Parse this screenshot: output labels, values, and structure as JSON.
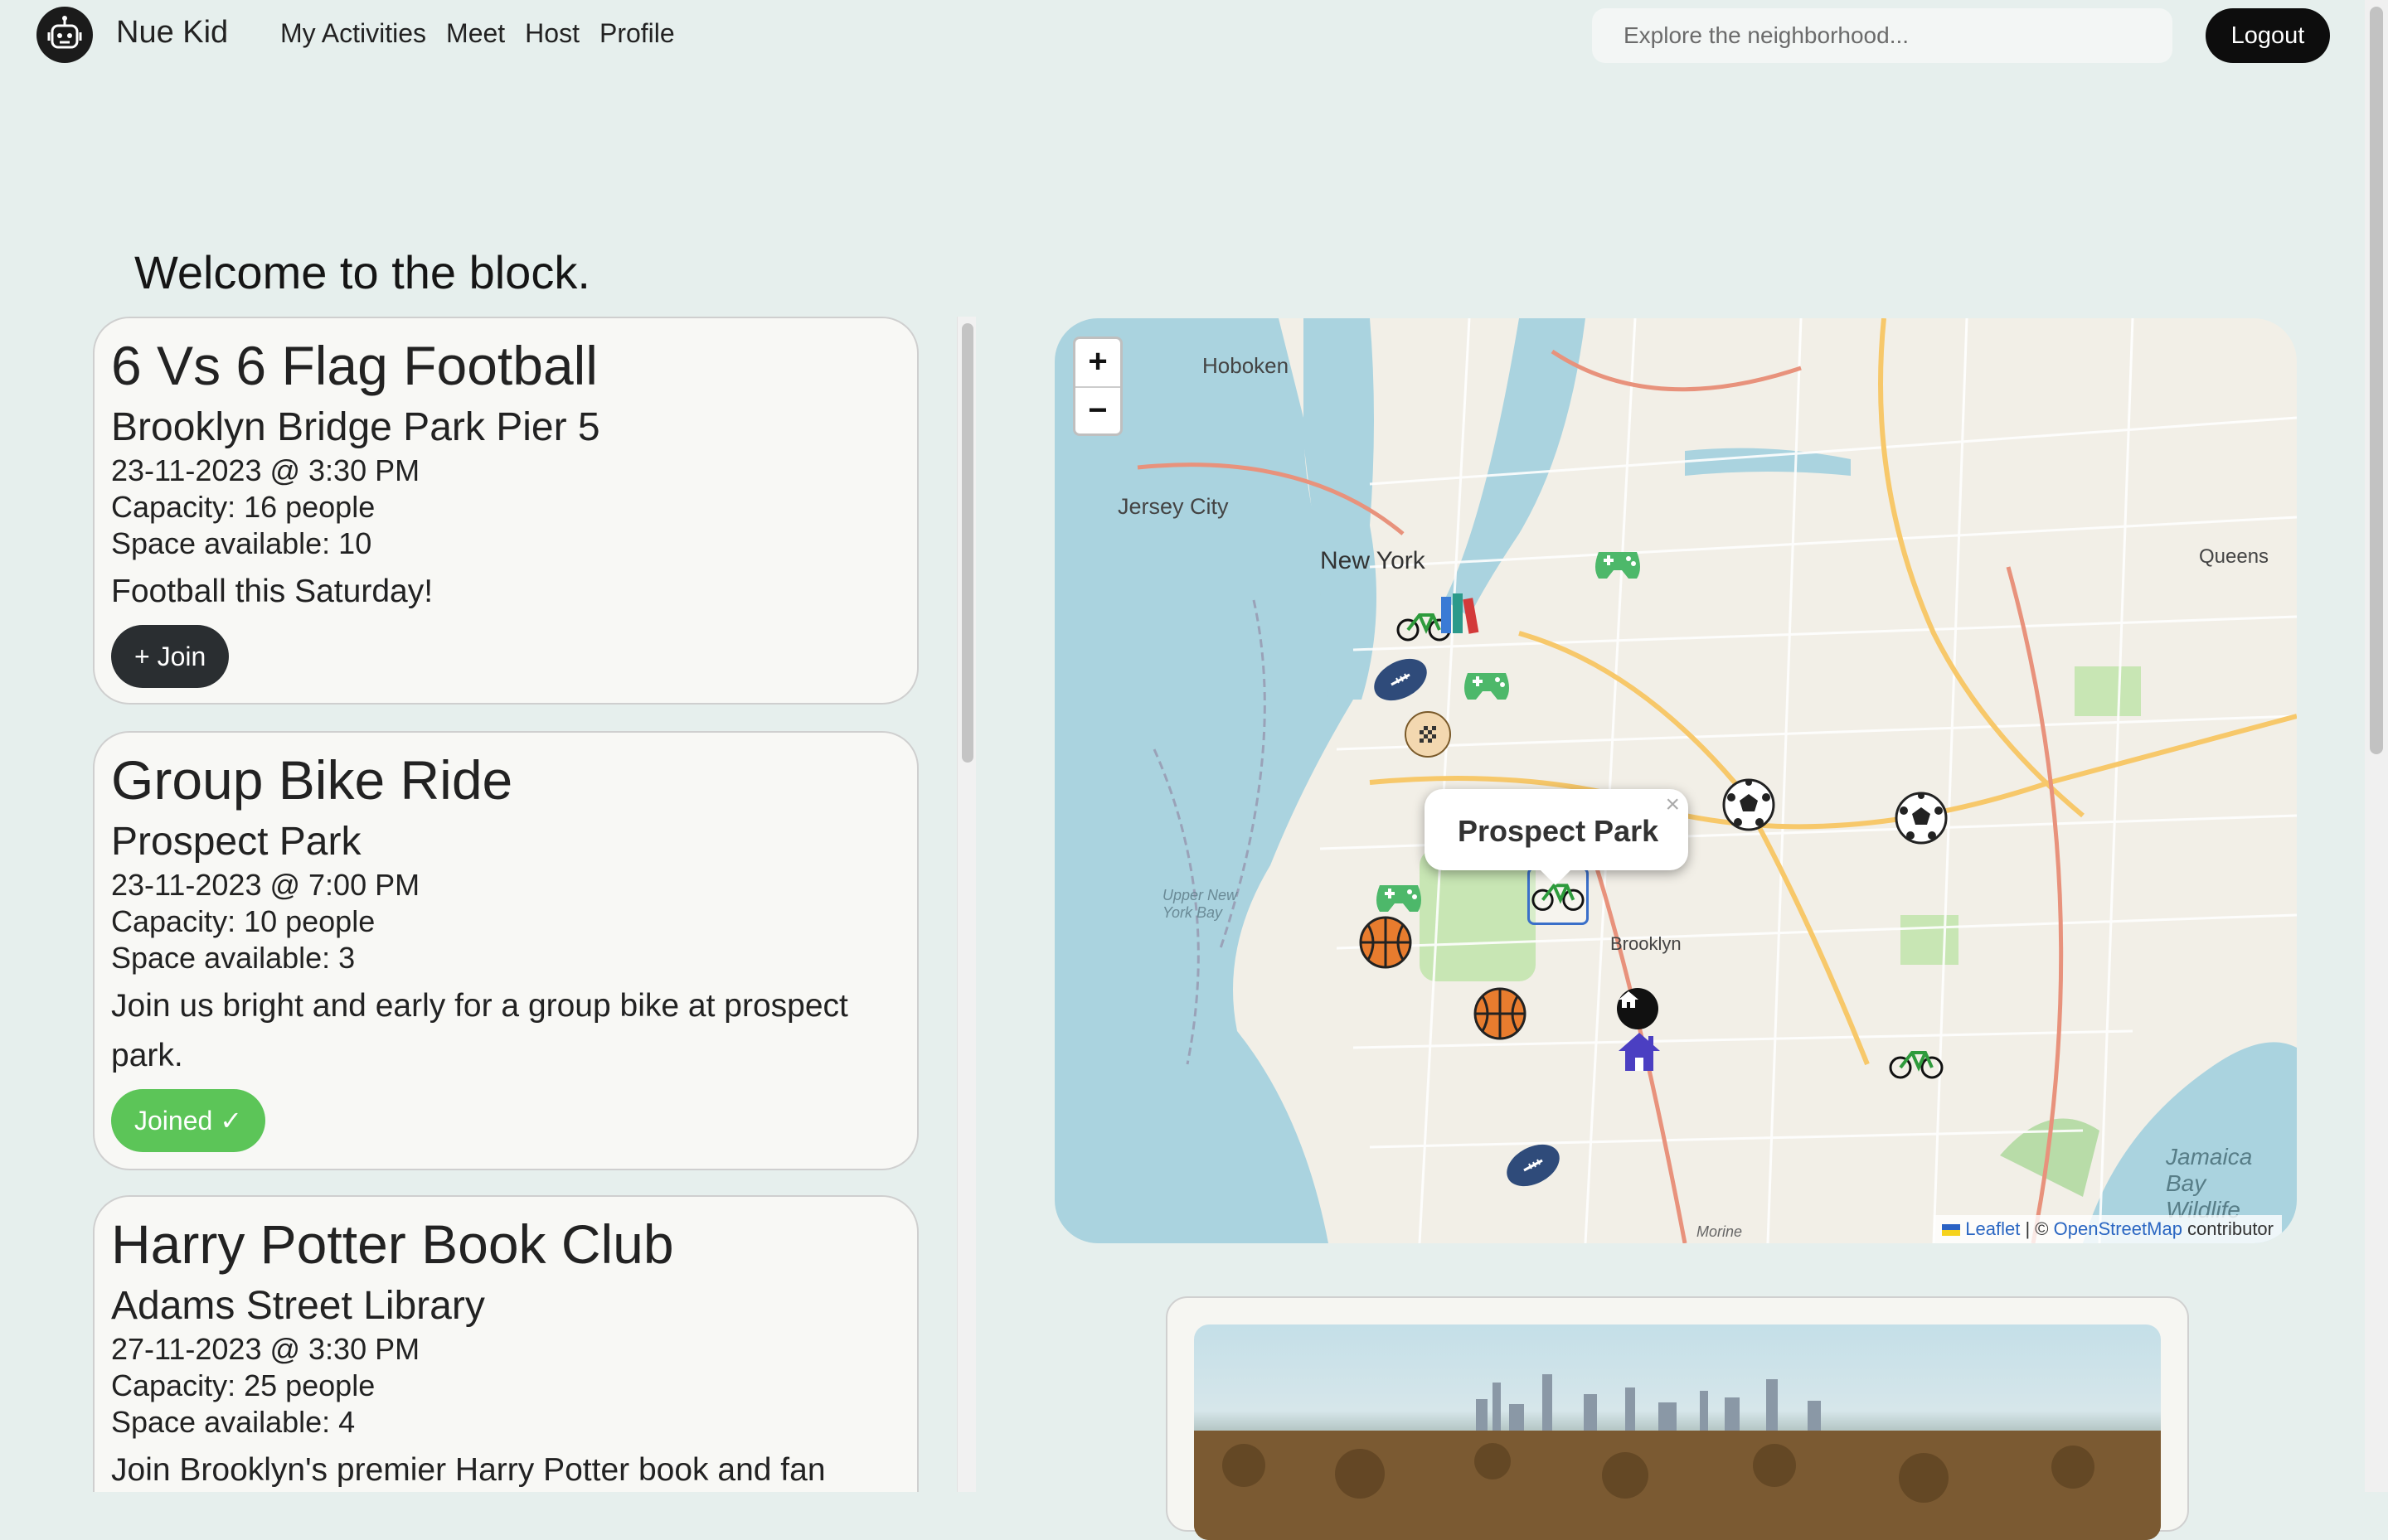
{
  "nav": {
    "brand": "Nue Kid",
    "links": [
      "My Activities",
      "Meet",
      "Host",
      "Profile"
    ],
    "search_placeholder": "Explore the neighborhood...",
    "logout_label": "Logout"
  },
  "welcome": "Welcome to the block.",
  "activities": [
    {
      "title": "6 Vs 6 Flag Football",
      "location": "Brooklyn Bridge Park Pier 5",
      "datetime": "23-11-2023 @ 3:30 PM",
      "capacity": "Capacity: 16 people",
      "space": "Space available: 10",
      "description": "Football this Saturday!",
      "button": "+ Join",
      "joined": false
    },
    {
      "title": "Group Bike Ride",
      "location": "Prospect Park",
      "datetime": "23-11-2023 @ 7:00 PM",
      "capacity": "Capacity: 10 people",
      "space": "Space available: 3",
      "description": "Join us bright and early for a group bike at prospect park.",
      "button": "Joined ✓",
      "joined": true
    },
    {
      "title": "Harry Potter Book Club",
      "location": "Adams Street Library",
      "datetime": "27-11-2023 @ 3:30 PM",
      "capacity": "Capacity: 25 people",
      "space": "Space available: 4",
      "description": "Join Brooklyn's premier Harry Potter book and fan"
    }
  ],
  "map": {
    "zoom_in": "+",
    "zoom_out": "−",
    "popup_title": "Prospect Park",
    "popup_close": "×",
    "labels": {
      "hoboken": "Hoboken",
      "jersey_city": "Jersey City",
      "new_york": "New York",
      "queens": "Queens",
      "brooklyn": "Brooklyn",
      "upper_ny_bay": "Upper New York Bay",
      "jamaica_bay": "Jamaica Bay Wildlife",
      "morine": "Morine"
    },
    "attribution_leaflet": "Leaflet",
    "attribution_sep": " | © ",
    "attribution_osm": "OpenStreetMap",
    "attribution_tail": " contributor"
  }
}
